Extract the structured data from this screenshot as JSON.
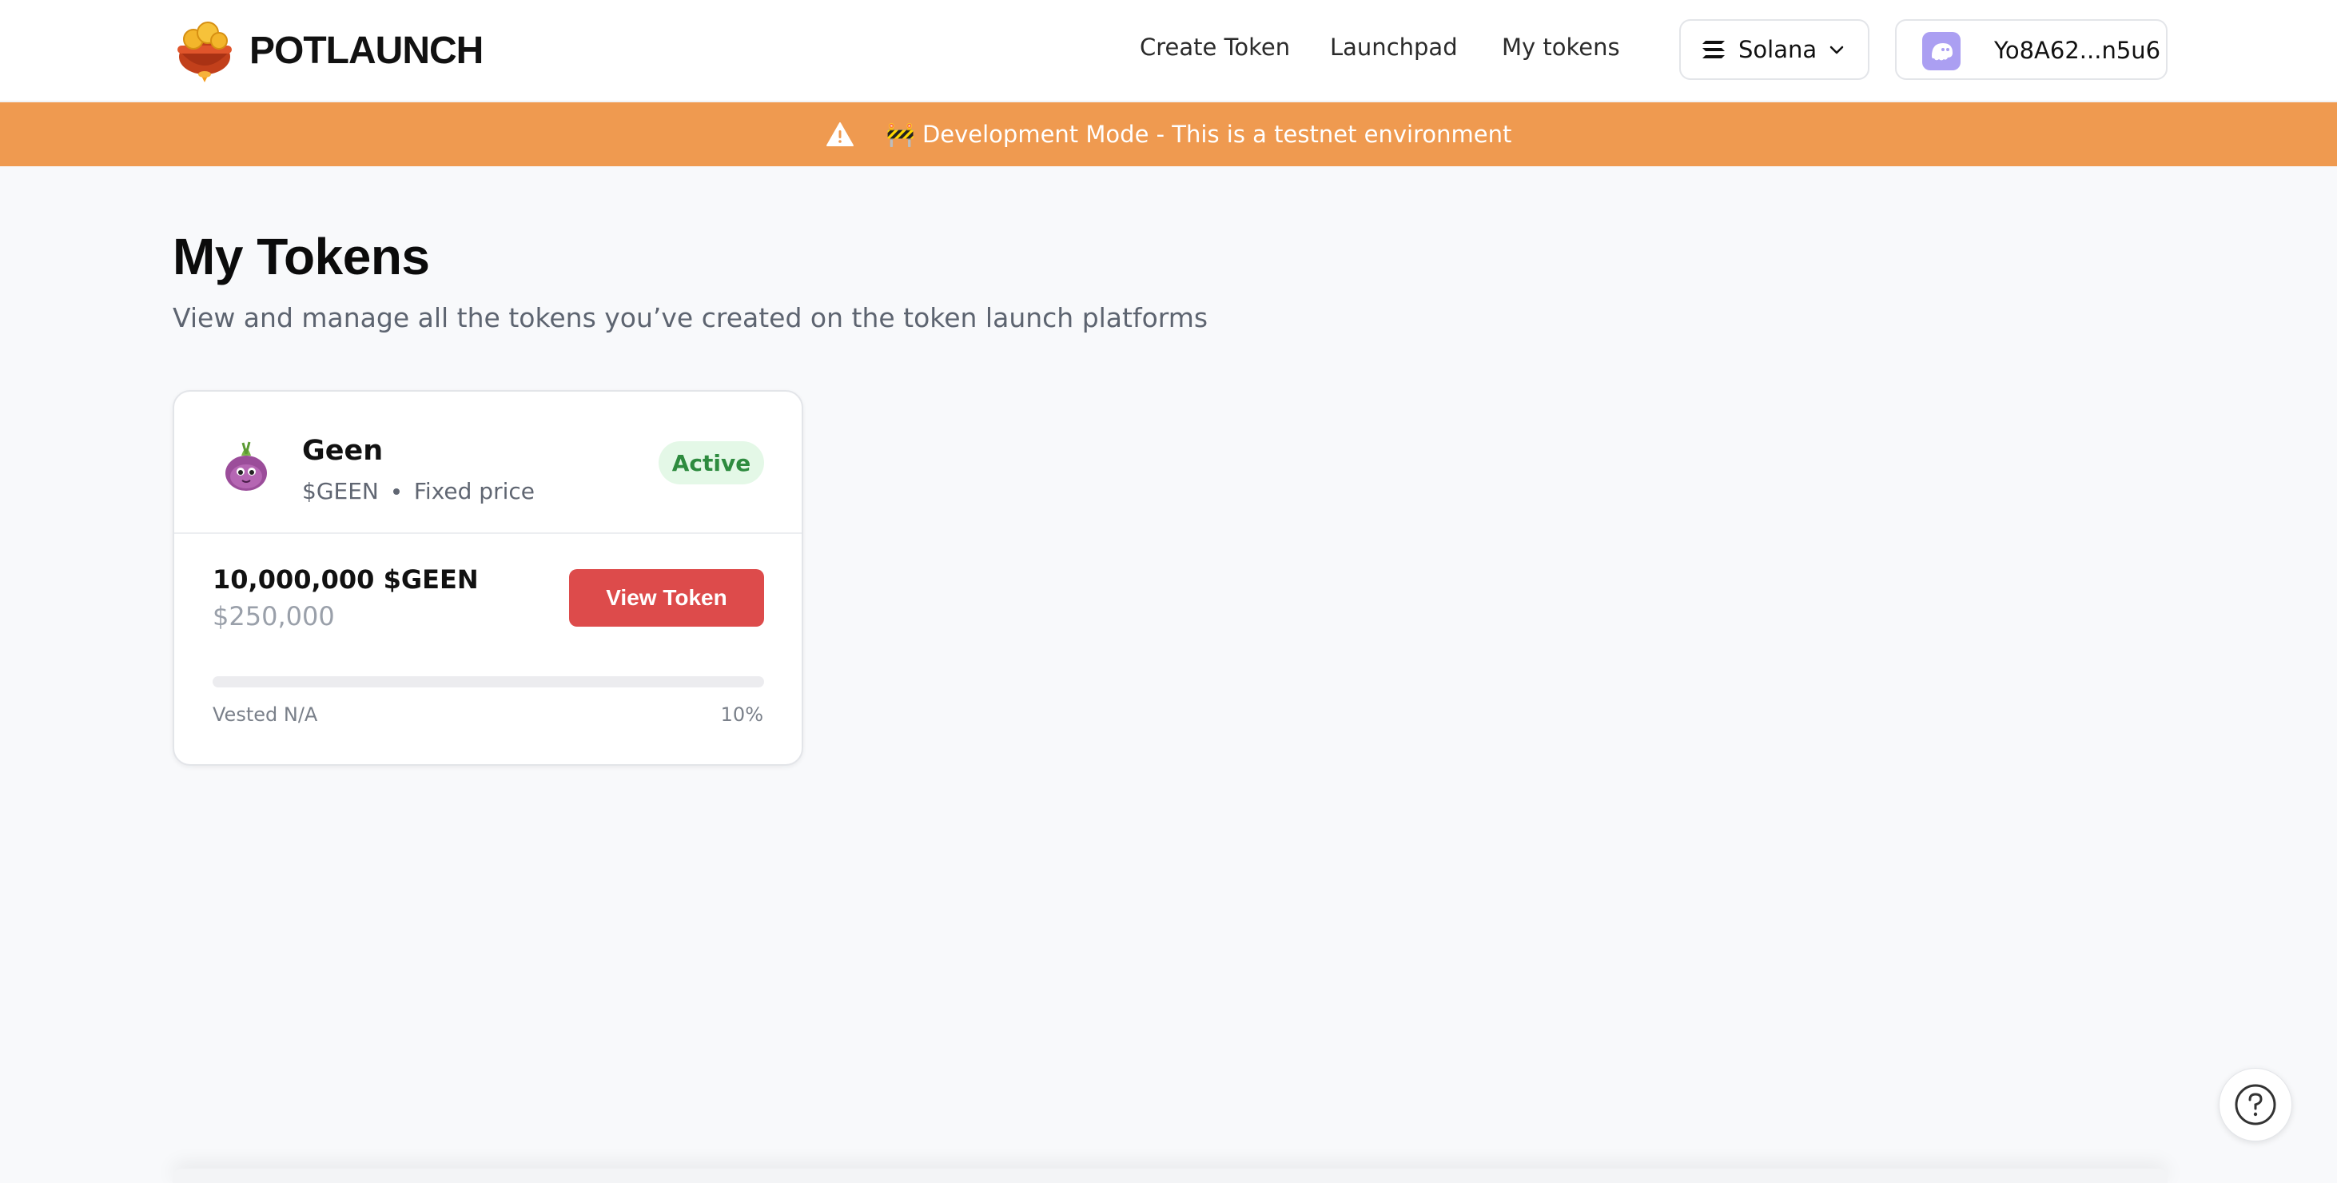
{
  "header": {
    "brand": "POTLAUNCH",
    "nav": [
      {
        "label": "Create Token"
      },
      {
        "label": "Launchpad"
      },
      {
        "label": "My tokens"
      }
    ],
    "network": {
      "label": "Solana",
      "icon": "solana-icon"
    },
    "wallet": {
      "address": "Yo8A62...n5u6",
      "icon": "phantom-icon"
    }
  },
  "banner": {
    "text": "🚧 Development Mode - This is a testnet environment",
    "icon": "warning-icon",
    "color": "#ef9a50"
  },
  "main": {
    "title": "My Tokens",
    "subtitle": "View and manage all the tokens you’ve created on the token launch platforms"
  },
  "tokens": [
    {
      "name": "Geen",
      "symbol": "$GEEN",
      "sale_type": "Fixed price",
      "status": "Active",
      "supply": "10,000,000 $GEEN",
      "usd_value": "$250,000",
      "action_label": "View Token",
      "vested_label": "Vested N/A",
      "percent_label": "10%",
      "progress": 0
    }
  ],
  "colors": {
    "accent": "#dd4b4b",
    "status_active_bg": "#e4f8e7",
    "status_active_text": "#2e8b3f"
  }
}
